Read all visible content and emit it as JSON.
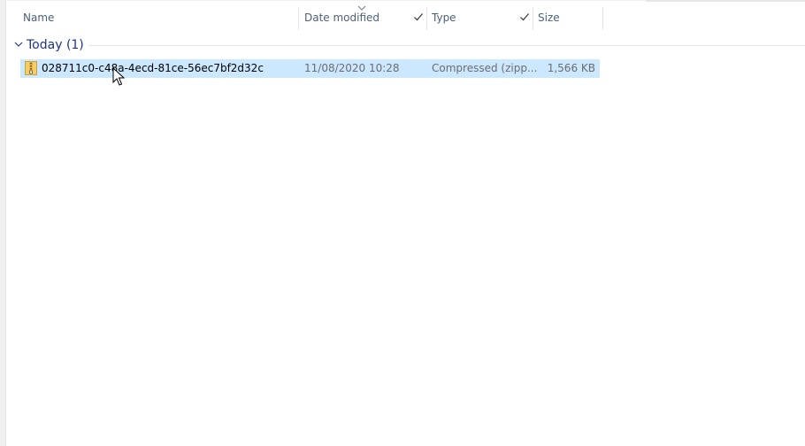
{
  "columns": {
    "name": "Name",
    "date_modified": "Date modified",
    "type": "Type",
    "size": "Size"
  },
  "group": {
    "label": "Today (1)"
  },
  "files": [
    {
      "name": "028711c0-c48a-4ecd-81ce-56ec7bf2d32c",
      "date_modified": "11/08/2020 10:28",
      "type": "Compressed (zipp...",
      "size": "1,566 KB",
      "icon": "zip-folder-icon",
      "selected": true
    }
  ],
  "colors": {
    "selection": "#cce8ff",
    "header_text": "#4c607a",
    "group_text": "#1e3287"
  }
}
